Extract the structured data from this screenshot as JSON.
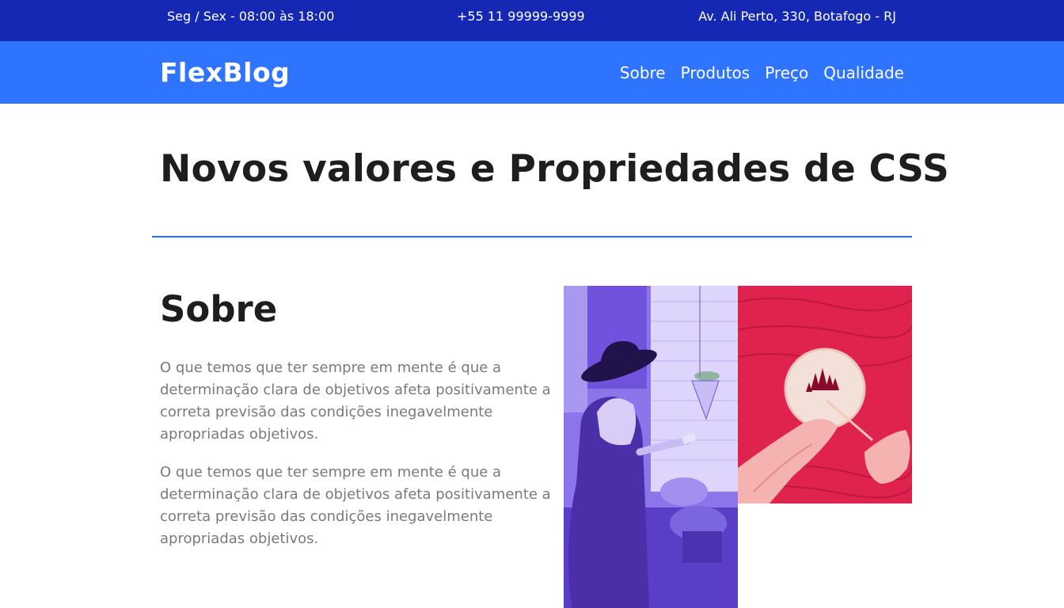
{
  "topbar": {
    "hours": "Seg / Sex - 08:00 às 18:00",
    "phone": "+55 11 99999-9999",
    "address": "Av. Ali Perto, 330, Botafogo - RJ"
  },
  "header": {
    "logo": "FlexBlog",
    "nav": [
      {
        "label": "Sobre"
      },
      {
        "label": "Produtos"
      },
      {
        "label": "Preço"
      },
      {
        "label": "Qualidade"
      }
    ]
  },
  "main": {
    "title": "Novos valores e Propriedades de CSS",
    "about": {
      "heading": "Sobre",
      "paragraphs": [
        "O que temos que ter sempre em mente é que a determinação clara de objetivos afeta positivamente a correta previsão das condições inegavelmente apropriadas objetivos.",
        "O que temos que ter sempre em mente é que a determinação clara de objetivos afeta positivamente a correta previsão das condições inegavelmente apropriadas objetivos."
      ]
    }
  },
  "colors": {
    "topbar_bg": "#1428b4",
    "navbar_bg": "#2f74ff",
    "divider": "#2a6fd6",
    "photo_purple": "#8a72e8",
    "photo_red": "#e0224f",
    "paragraph_text": "#7a7a7a"
  }
}
